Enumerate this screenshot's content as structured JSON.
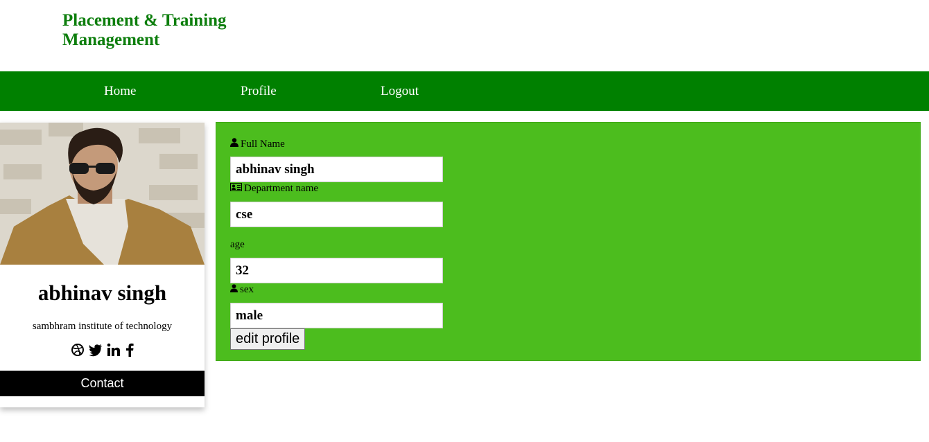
{
  "header": {
    "brand_line1": "Placement & Training",
    "brand_line2": "Management"
  },
  "nav": {
    "home": "Home",
    "profile": "Profile",
    "logout": "Logout"
  },
  "card": {
    "name": "abhinav singh",
    "institute": "sambhram institute of technology",
    "contact_label": "Contact",
    "social_icons": [
      "dribbble-icon",
      "twitter-icon",
      "linkedin-icon",
      "facebook-icon"
    ]
  },
  "form": {
    "full_name_label": "Full Name",
    "full_name_value": "abhinav singh",
    "department_label": "Department name",
    "department_value": "cse",
    "age_label": "age",
    "age_value": "32",
    "sex_label": "sex",
    "sex_value": "male",
    "edit_button": "edit profile"
  },
  "colors": {
    "brand_green": "#0d7e0d",
    "navbar_green": "#008000",
    "panel_green": "#4cbd1e"
  }
}
